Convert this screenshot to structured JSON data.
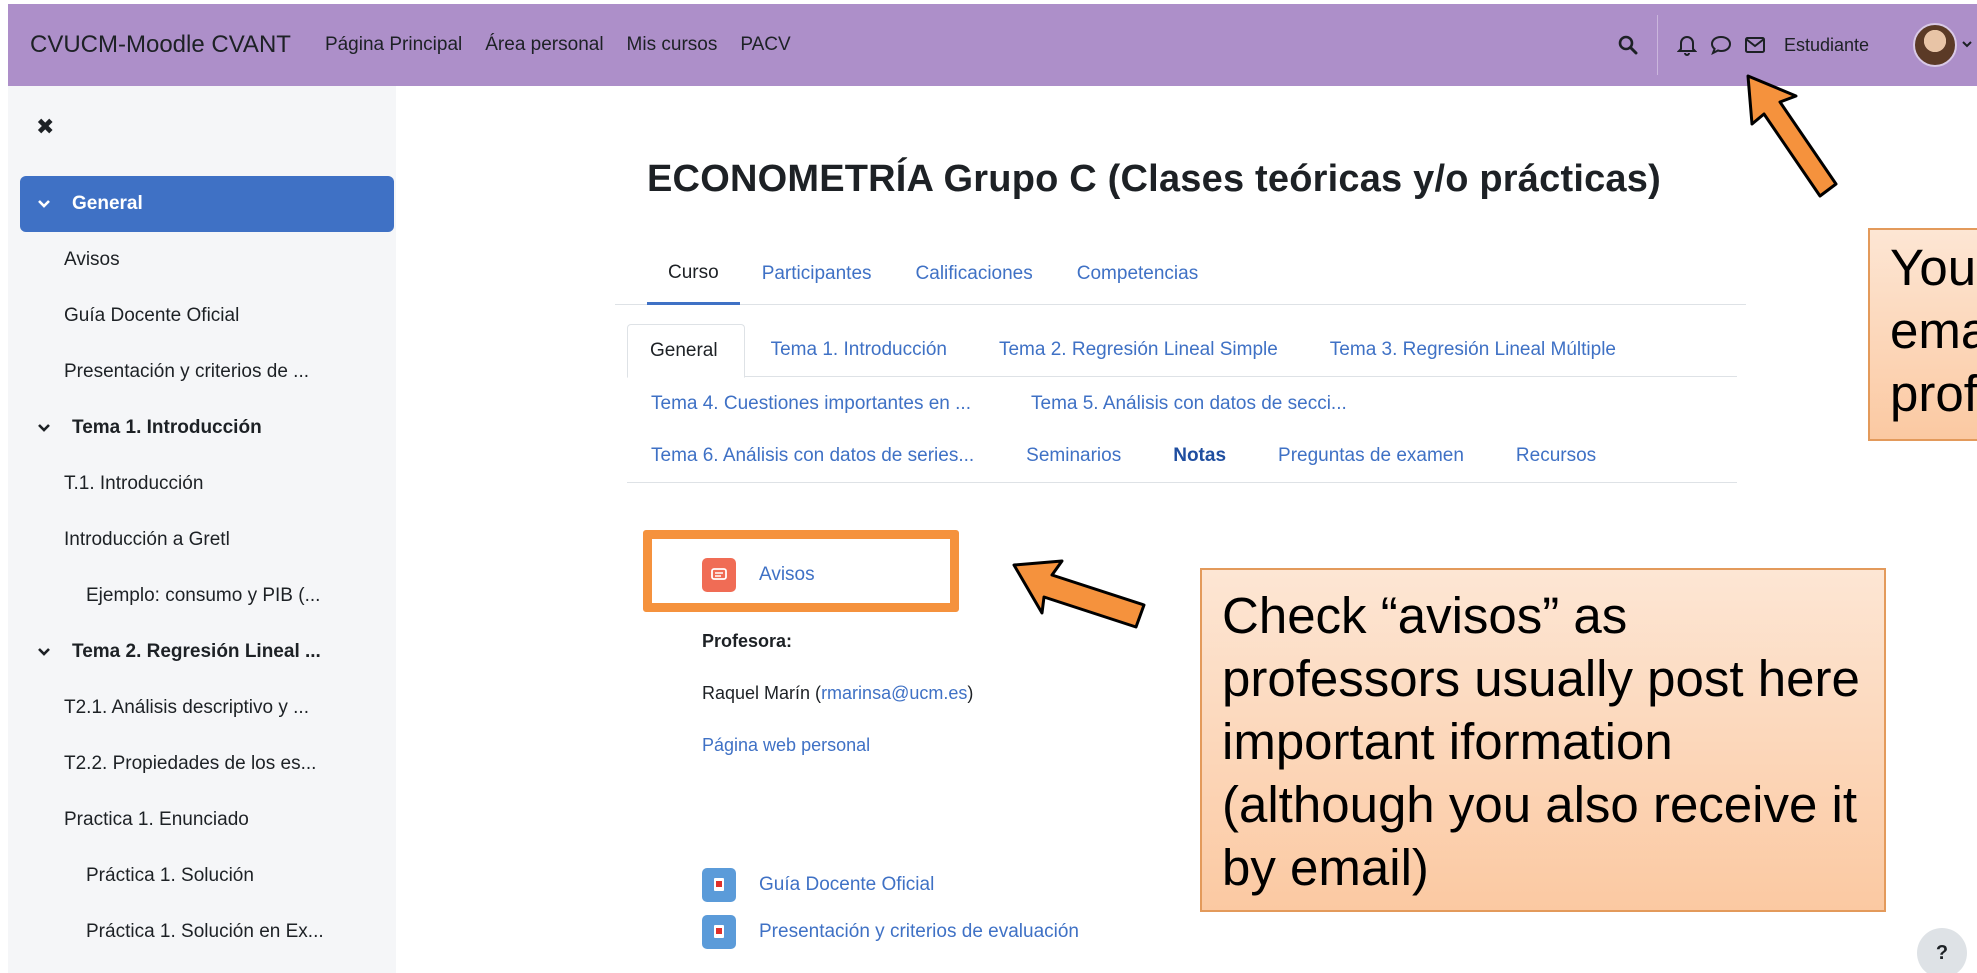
{
  "navbar": {
    "brand": "CVUCM-Moodle CVANT",
    "links": [
      "Página Principal",
      "Área personal",
      "Mis cursos",
      "PACV"
    ],
    "user_name": "Estudiante",
    "icons": [
      "search-icon",
      "bell-icon",
      "chat-icon",
      "mail-icon"
    ]
  },
  "drawer": {
    "close_icon": "✖",
    "items": [
      {
        "label": "General",
        "type": "section"
      },
      {
        "label": "Avisos"
      },
      {
        "label": "Guía Docente Oficial"
      },
      {
        "label": "Presentación y criterios de ..."
      },
      {
        "label": "Tema 1. Introducción",
        "type": "section"
      },
      {
        "label": "T.1. Introducción"
      },
      {
        "label": "Introducción a Gretl"
      },
      {
        "label": "Ejemplo: consumo y PIB (..."
      },
      {
        "label": "Tema 2. Regresión Lineal ...",
        "type": "section"
      },
      {
        "label": "T2.1. Análisis descriptivo y ..."
      },
      {
        "label": "T2.2. Propiedades de los es..."
      },
      {
        "label": "Practica 1. Enunciado"
      },
      {
        "label": "Práctica 1. Solución"
      },
      {
        "label": "Práctica 1. Solución en Ex..."
      }
    ]
  },
  "course": {
    "title": "ECONOMETRÍA Grupo C (Clases teóricas y/o prácticas)",
    "tabs": [
      "Curso",
      "Participantes",
      "Calificaciones",
      "Competencias"
    ],
    "section_tabs_row1": [
      "General",
      "Tema 1. Introducción",
      "Tema 2. Regresión Lineal Simple",
      "Tema 3. Regresión Lineal Múltiple"
    ],
    "section_tabs_row2": [
      "Tema 4. Cuestiones importantes en ...",
      "Tema 5. Análisis con datos de secci..."
    ],
    "section_tabs_row3": [
      "Tema 6. Análisis con datos de series...",
      "Seminarios",
      "Notas",
      "Preguntas de examen",
      "Recursos"
    ]
  },
  "content": {
    "avisos": "Avisos",
    "profesora_label": "Profesora:",
    "teacher_name": "Raquel Marín (",
    "teacher_email": "rmarinsa@ucm.es",
    "teacher_close": ")",
    "personal_page": "Página web personal",
    "guia": "Guía Docente Oficial",
    "presentacion": "Presentación y criterios de evaluación"
  },
  "annotations": {
    "main_callout": "Check “avisos” as professors usually post here important iformation (although you also receive it by email)",
    "right_callout_lines": [
      "You",
      "ema",
      "prof"
    ]
  },
  "help": "?",
  "colors": {
    "navbar": "#ad8fc9",
    "accent": "#3f71c5",
    "highlight": "#f5923d",
    "callout_bg": "#fbc9a2"
  }
}
